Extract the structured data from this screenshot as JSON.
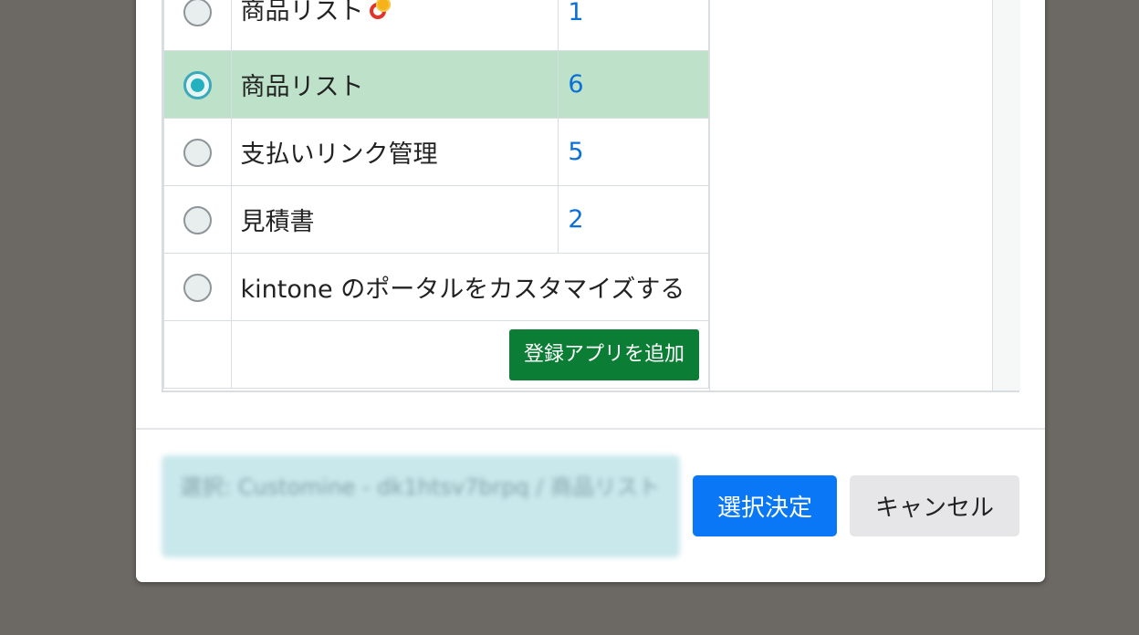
{
  "apps": [
    {
      "name": "商品リスト",
      "id": "1",
      "has_icon": true,
      "selected": false
    },
    {
      "name": "商品リスト",
      "id": "6",
      "has_icon": false,
      "selected": true
    },
    {
      "name": "支払いリンク管理",
      "id": "5",
      "has_icon": false,
      "selected": false
    },
    {
      "name": "見積書",
      "id": "2",
      "has_icon": false,
      "selected": false
    },
    {
      "name": "kintone のポータルをカスタマイズする",
      "id": "",
      "has_icon": false,
      "selected": false
    }
  ],
  "table": {
    "add_app_label": "登録アプリを追加"
  },
  "footer": {
    "selection_status": "選択: Customine - dk1htsv7brpq / 商品リスト",
    "confirm_label": "選択決定",
    "cancel_label": "キャンセル"
  },
  "colors": {
    "selected_row": "#bde2c9",
    "primary_button": "#0a78f6",
    "add_button": "#0b7d34",
    "id_link": "#0a6fd6"
  },
  "icons": {
    "app_icon": "flower-ring-icon"
  }
}
